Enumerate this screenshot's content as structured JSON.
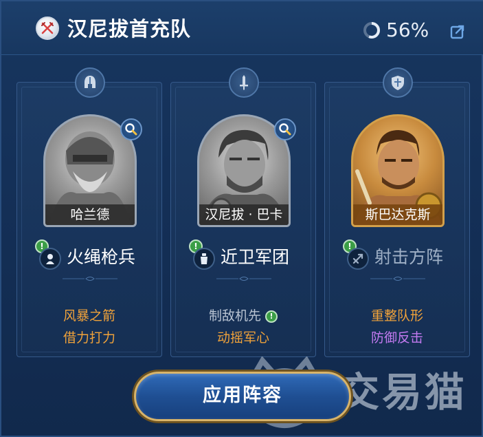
{
  "header": {
    "team_name": "汉尼拔首充队",
    "progress_label": "56%",
    "progress_value": 0.56
  },
  "cards": [
    {
      "role_icon": "helmet-icon",
      "hero_name": "哈兰德",
      "portrait_style": "gray",
      "unit_name": "火绳枪兵",
      "unit_icon": "musketeer-icon",
      "unit_active": true,
      "skills": [
        {
          "label": "风暴之箭",
          "color": "#f0a23a"
        },
        {
          "label": "借力打力",
          "color": "#f0a23a"
        }
      ]
    },
    {
      "role_icon": "sword-icon",
      "hero_name": "汉尼拔 · 巴卡",
      "portrait_style": "gray",
      "unit_name": "近卫军团",
      "unit_icon": "guard-icon",
      "unit_active": true,
      "skills": [
        {
          "label": "制敌机先",
          "color": "#b8c3d2",
          "warning": "!"
        },
        {
          "label": "动摇军心",
          "color": "#f0a23a"
        }
      ]
    },
    {
      "role_icon": "shield-icon",
      "hero_name": "斯巴达克斯",
      "portrait_style": "gold",
      "unit_name": "射击方阵",
      "unit_icon": "archer-formation-icon",
      "unit_active": false,
      "skills": [
        {
          "label": "重整队形",
          "color": "#f0a23a"
        },
        {
          "label": "防御反击",
          "color": "#c37af0"
        }
      ]
    }
  ],
  "badge_text": "!",
  "apply_button": {
    "label": "应用阵容"
  },
  "watermark": {
    "text": "交易猫"
  }
}
